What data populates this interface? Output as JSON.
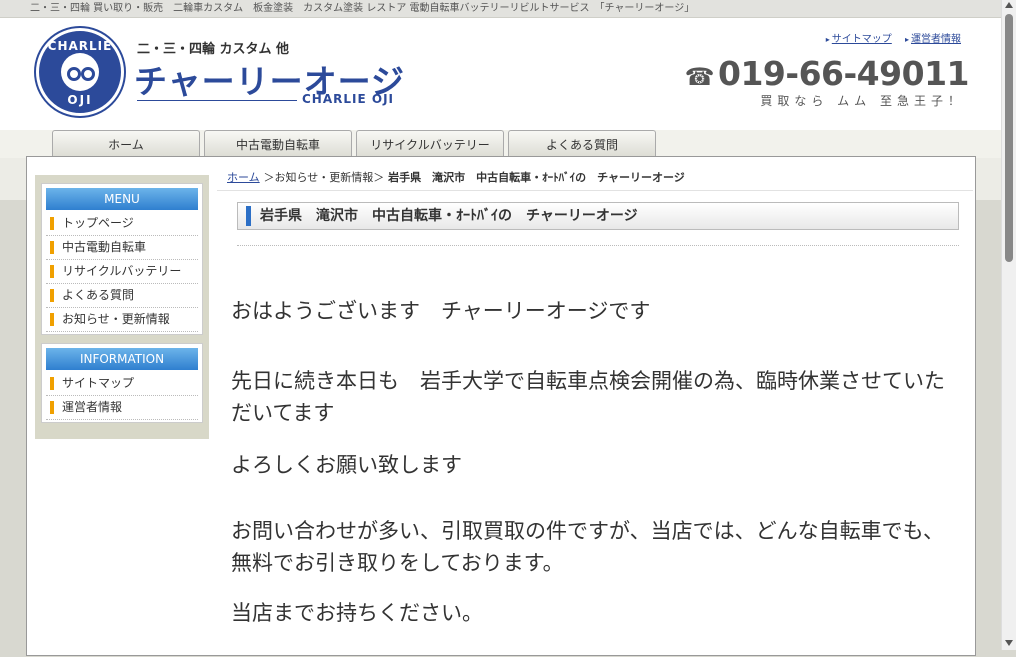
{
  "topbar": {
    "text": "二・三・四輪 買い取り・販売　二輪車カスタム　板金塗装　カスタム塗装 レストア 電動自転車バッテリーリビルトサービス　「チャーリーオージ」"
  },
  "header": {
    "logo": {
      "ring_top": "CHARLIE",
      "ring_bottom": "OJI"
    },
    "tagline": "二・三・四輪 カスタム 他",
    "brand_name": "チャーリーオージ",
    "brand_en": "CHARLIE OJI",
    "links": [
      {
        "label": "サイトマップ"
      },
      {
        "label": "運営者情報"
      }
    ],
    "phone_icon": "☎",
    "phone": "019-66-49011",
    "phone_sub": "買取なら ムム 至急王子！"
  },
  "nav": {
    "tabs": [
      {
        "label": "ホーム"
      },
      {
        "label": "中古電動自転車"
      },
      {
        "label": "リサイクルバッテリー"
      },
      {
        "label": "よくある質問"
      }
    ]
  },
  "sidebar": {
    "menu": {
      "title": "MENU",
      "items": [
        {
          "label": "トップページ"
        },
        {
          "label": "中古電動自転車"
        },
        {
          "label": "リサイクルバッテリー"
        },
        {
          "label": "よくある質問"
        },
        {
          "label": "お知らせ・更新情報"
        }
      ]
    },
    "info": {
      "title": "INFORMATION",
      "items": [
        {
          "label": "サイトマップ"
        },
        {
          "label": "運営者情報"
        }
      ]
    }
  },
  "breadcrumb": {
    "home": "ホーム",
    "mid": "＞お知らせ・更新情報＞",
    "current": "岩手県　滝沢市　中古自転車・ｵｰﾄﾊﾞｲの　チャーリーオージ"
  },
  "page_title": "岩手県　滝沢市　中古自転車・ｵｰﾄﾊﾞｲの　チャーリーオージ",
  "article": {
    "p1": "おはようございます　チャーリーオージです",
    "p2": "先日に続き本日も　岩手大学で自転車点検会開催の為、臨時休業させていただいてます",
    "p3": "よろしくお願い致します",
    "p4": "お問い合わせが多い、引取買取の件ですが、当店では、どんな自転車でも、無料でお引き取りをしております。",
    "p5": "当店までお持ちください。"
  }
}
